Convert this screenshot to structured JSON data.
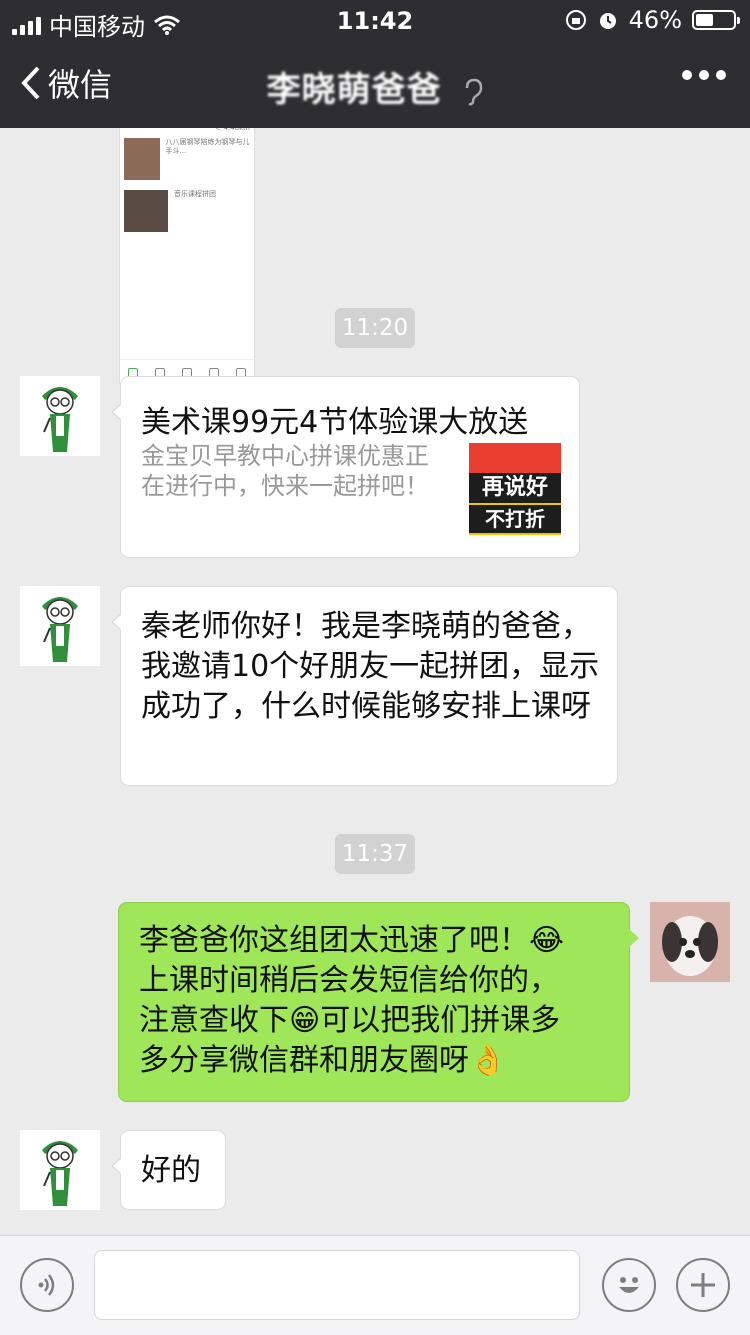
{
  "status_bar": {
    "carrier": "中国移动",
    "time": "11:42",
    "battery": "46%",
    "battery_level": 0.46
  },
  "nav": {
    "back_label": "微信",
    "title": "李晓萌爸爸"
  },
  "shared_screenshot": {
    "items": [
      {
        "title": "八八届钢琴陪练为钢琴与儿手斗..."
      },
      {
        "title": "音乐课程拼团"
      }
    ]
  },
  "messages": {
    "time1": "11:20",
    "link_card": {
      "title": "美术课99元4节体验课大放送",
      "description": "金宝贝早教中心拼课优惠正在进行中，快来一起拼吧！",
      "thumb_text_1": "再说好",
      "thumb_text_2": "不打折"
    },
    "msg1": "秦老师你好！我是李晓萌的爸爸，我邀请10个好朋友一起拼团，显示成功了，什么时候能够安排上课呀",
    "time2": "11:37",
    "reply_lines": [
      "李爸爸你这组团太迅速了吧！😂",
      "上课时间稍后会发短信给你的，",
      "注意查收下😁可以把我们拼课多",
      "多分享微信群和朋友圈呀👌"
    ],
    "msg2": "好的"
  },
  "input_bar": {
    "voice_icon": "voice-icon",
    "emoji_icon": "emoji-icon",
    "plus_icon": "plus-icon"
  },
  "colors": {
    "nav_bg": "#2e2e32",
    "chat_bg": "#ebebeb",
    "outgoing_bubble": "#9fe658",
    "timestamp_bg": "#d2d2d2"
  }
}
